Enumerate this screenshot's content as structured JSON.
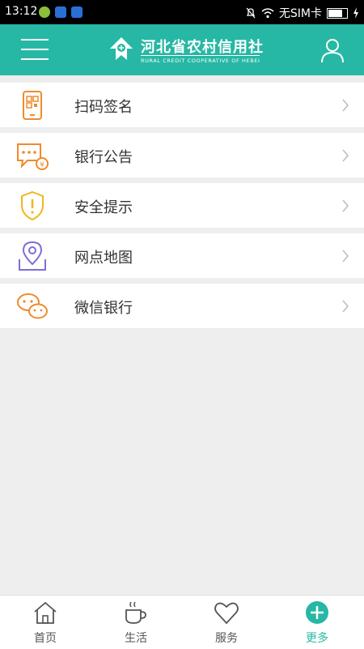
{
  "status": {
    "time": "13:12",
    "carrier": "无SIM卡"
  },
  "header": {
    "logo_cn": "河北省农村信用社",
    "logo_en": "RURAL CREDIT COOPERATIVE OF HEBEI"
  },
  "menu": [
    {
      "label": "扫码签名",
      "icon": "qr-phone-icon"
    },
    {
      "label": "银行公告",
      "icon": "announcement-icon"
    },
    {
      "label": "安全提示",
      "icon": "shield-warning-icon"
    },
    {
      "label": "网点地图",
      "icon": "map-pin-icon"
    },
    {
      "label": "微信银行",
      "icon": "wechat-icon"
    }
  ],
  "tabs": [
    {
      "label": "首页",
      "icon": "home-icon"
    },
    {
      "label": "生活",
      "icon": "coffee-icon"
    },
    {
      "label": "服务",
      "icon": "heart-icon"
    },
    {
      "label": "更多",
      "icon": "plus-icon",
      "active": true
    }
  ],
  "colors": {
    "accent": "#26b8a4",
    "orange": "#f08a2c",
    "purple": "#7d6fd6",
    "yellow": "#f3b51b"
  }
}
